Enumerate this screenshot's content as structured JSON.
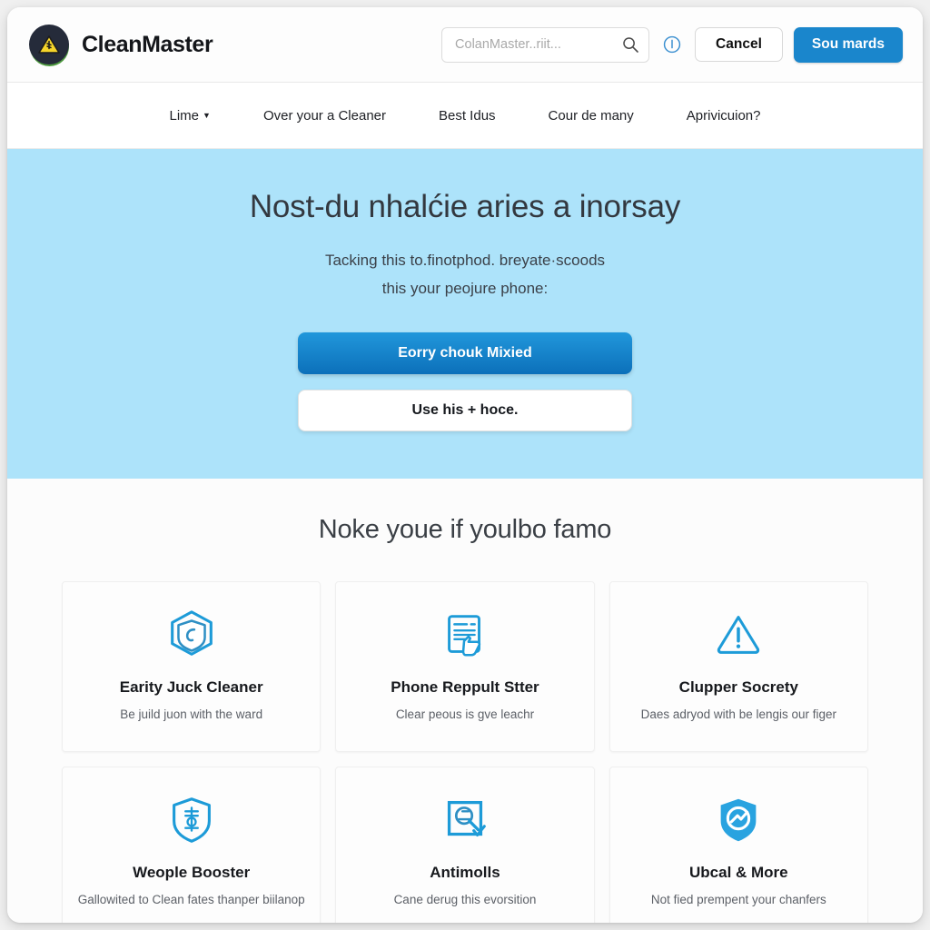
{
  "header": {
    "logo_icon": "warning-triangle-logo",
    "brand_name": "CleanMaster",
    "search": {
      "placeholder": "ColanMaster..riit...",
      "value": "",
      "icon": "search-icon"
    },
    "info_icon": "info-circle-icon",
    "cancel_label": "Cancel",
    "primary_label": "Sou mards"
  },
  "nav": {
    "items": [
      {
        "label": "Lime",
        "has_caret": true
      },
      {
        "label": "Over your a Cleaner",
        "has_caret": false
      },
      {
        "label": "Best Idus",
        "has_caret": false
      },
      {
        "label": "Cour de many",
        "has_caret": false
      },
      {
        "label": "Aprivicuion?",
        "has_caret": false
      }
    ]
  },
  "hero": {
    "title": "Nost-du nhalćie aries a inorsay",
    "subtitle_line1": "Tacking this to.finotphod. breyate·scoods",
    "subtitle_line2": "this your peojure phone:",
    "primary_button": "Eorry chouk Mixied",
    "secondary_button": "Use his + hoce.",
    "background_color": "#ade3fa"
  },
  "features": {
    "heading": "Noke youe if youlbo famo",
    "cards": [
      {
        "icon": "shield-hexagon-check-icon",
        "title": "Earity Juck Cleaner",
        "desc": "Be juild juon with the ward"
      },
      {
        "icon": "document-hand-icon",
        "title": "Phone Reppult Stter",
        "desc": "Clear peous is gve leachr"
      },
      {
        "icon": "warning-triangle-icon",
        "title": "Clupper Socrety",
        "desc": "Daes adryod with be lengis our figer"
      },
      {
        "icon": "shield-boost-icon",
        "title": "Weople Booster",
        "desc": "Gallowited to Clean fates thanper biilanop"
      },
      {
        "icon": "scan-magnifier-icon",
        "title": "Antimolls",
        "desc": "Cane derug this evorsition"
      },
      {
        "icon": "shield-check-filled-icon",
        "title": "Ubcal & More",
        "desc": "Not fied prempent your chanfers"
      }
    ]
  },
  "colors": {
    "accent_blue": "#1a86cc",
    "hero_blue": "#ade3fa",
    "icon_blue": "#1d9bd8",
    "logo_dark": "#252b3a",
    "logo_yellow": "#f5d52a",
    "logo_green": "#4e9a3f"
  }
}
